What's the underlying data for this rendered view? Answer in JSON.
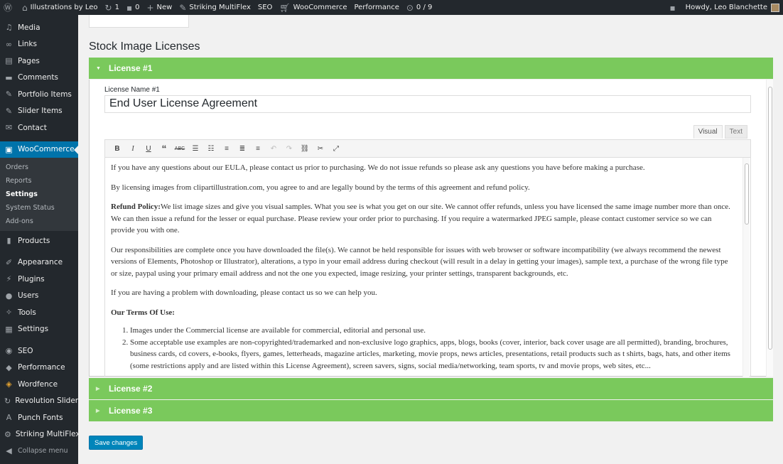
{
  "adminbar": {
    "site_name": "Illustrations by Leo",
    "updates": "1",
    "comments": "0",
    "new_label": "New",
    "striking": "Striking MultiFlex",
    "seo": "SEO",
    "woocommerce": "WooCommerce",
    "performance": "Performance",
    "counter": "0 / 9",
    "howdy": "Howdy, Leo Blanchette"
  },
  "sidebar": {
    "items_top": [
      "Media",
      "Links",
      "Pages",
      "Comments",
      "Portfolio Items",
      "Slider Items",
      "Contact"
    ],
    "current": "WooCommerce",
    "submenu": [
      "Orders",
      "Reports",
      "Settings",
      "System Status",
      "Add-ons"
    ],
    "products": "Products",
    "items_mid": [
      "Appearance",
      "Plugins",
      "Users",
      "Tools",
      "Settings"
    ],
    "items_bottom": [
      "SEO",
      "Performance",
      "Wordfence",
      "Revolution Slider",
      "Punch Fonts",
      "Striking MultiFlex"
    ],
    "collapse": "Collapse menu"
  },
  "main": {
    "title": "Stock Image Licenses",
    "licenses": [
      "License #1",
      "License #2",
      "License #3"
    ],
    "field_label": "License Name #1",
    "field_value": "End User License Agreement",
    "tab_visual": "Visual",
    "tab_text": "Text",
    "save_label": "Save changes"
  },
  "content": {
    "p1": "If you have any questions about our EULA, please contact us prior to purchasing. We do not issue refunds so please ask any questions you have before making a purchase.",
    "p2": "By licensing images from clipartillustration.com, you agree to and are legally bound by the terms of this agreement and refund policy.",
    "p3_bold": "Refund Policy:",
    "p3": "We list image sizes and give you visual samples. What you see is what you get on our site. We cannot offer refunds, unless you have licensed the same image number more than once. We can then issue a refund for the lesser or equal purchase. Please review your order prior to purchasing. If you require a watermarked JPEG sample, please contact customer service so we can provide you with one.",
    "p4": "Our responsibilities are complete once you have downloaded the file(s). We cannot be held responsible for issues with web browser or software incompatibility (we always recommend the newest versions of Elements, Photoshop or Illustrator), alterations, a typo in your email address during checkout (will result in a delay in getting your images), sample text, a purchase of the wrong file type or size, paypal using your primary email address and not the one you expected, image resizing, your printer settings, transparent backgrounds, etc.",
    "p5": "If you are having a problem with downloading, please contact us so we can help you.",
    "h_terms": "Our Terms Of Use:",
    "li1": "Images under the Commercial license are available for commercial, editorial and personal use.",
    "li2": "Some acceptable use examples are non-copyrighted/trademarked and non-exclusive logo graphics, apps, blogs, books (cover, interior, back cover usage are all permitted), branding, brochures, business cards, cd covers, e-books, flyers, games, letterheads, magazine articles, marketing, movie props, news articles, presentations, retail products such as t shirts, bags, hats, and other items (some restrictions apply and are listed within this License Agreement), screen savers, signs, social media/networking, team sports, tv and movie props, web sites, etc..."
  }
}
